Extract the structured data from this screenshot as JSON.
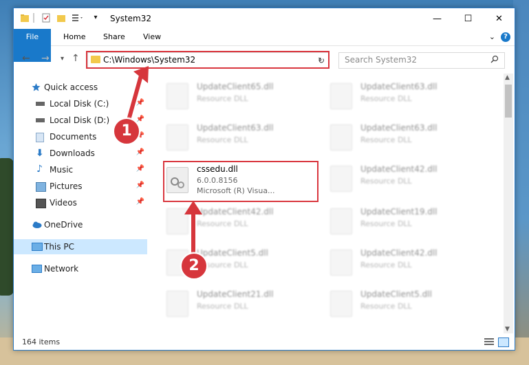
{
  "window": {
    "title": "System32"
  },
  "ribbon": {
    "tabs": [
      "File",
      "Home",
      "Share",
      "View"
    ]
  },
  "address": {
    "path": "C:\\Windows\\System32"
  },
  "search": {
    "placeholder": "Search System32"
  },
  "sidebar": {
    "items": [
      {
        "label": "Quick access",
        "icon": "star-icon"
      },
      {
        "label": "Local Disk (C:)",
        "icon": "drive-icon"
      },
      {
        "label": "Local Disk (D:)",
        "icon": "drive-icon"
      },
      {
        "label": "Documents",
        "icon": "documents-icon"
      },
      {
        "label": "Downloads",
        "icon": "download-icon"
      },
      {
        "label": "Music",
        "icon": "music-icon"
      },
      {
        "label": "Pictures",
        "icon": "pictures-icon"
      },
      {
        "label": "Videos",
        "icon": "videos-icon"
      },
      {
        "label": "OneDrive",
        "icon": "cloud-icon"
      },
      {
        "label": "This PC",
        "icon": "computer-icon"
      },
      {
        "label": "Network",
        "icon": "network-icon"
      }
    ]
  },
  "files": {
    "left": [
      {
        "name": "UpdateClient65.dll",
        "type": "Resource DLL"
      },
      {
        "name": "UpdateClient63.dll",
        "type": "Resource DLL"
      },
      {
        "name": "cssedu.dll",
        "version": "6.0.0.8156",
        "description": "Microsoft (R) Visua..."
      },
      {
        "name": "UpdateClient42.dll",
        "type": "Resource DLL"
      },
      {
        "name": "UpdateClient5.dll",
        "type": "Resource DLL"
      },
      {
        "name": "UpdateClient21.dll",
        "type": "Resource DLL"
      }
    ],
    "right": [
      {
        "name": "UpdateClient63.dll",
        "type": "Resource DLL"
      },
      {
        "name": "UpdateClient63.dll",
        "type": "Resource DLL"
      },
      {
        "name": "UpdateClient42.dll",
        "type": "Resource DLL"
      },
      {
        "name": "UpdateClient19.dll",
        "type": "Resource DLL"
      },
      {
        "name": "UpdateClient42.dll",
        "type": "Resource DLL"
      },
      {
        "name": "UpdateClient5.dll",
        "type": "Resource DLL"
      }
    ]
  },
  "status": {
    "count": "164 items"
  },
  "annotations": {
    "step1": "1",
    "step2": "2"
  },
  "colors": {
    "accent": "#1979ca",
    "highlight": "#d9363e",
    "selection": "#cce8ff"
  }
}
